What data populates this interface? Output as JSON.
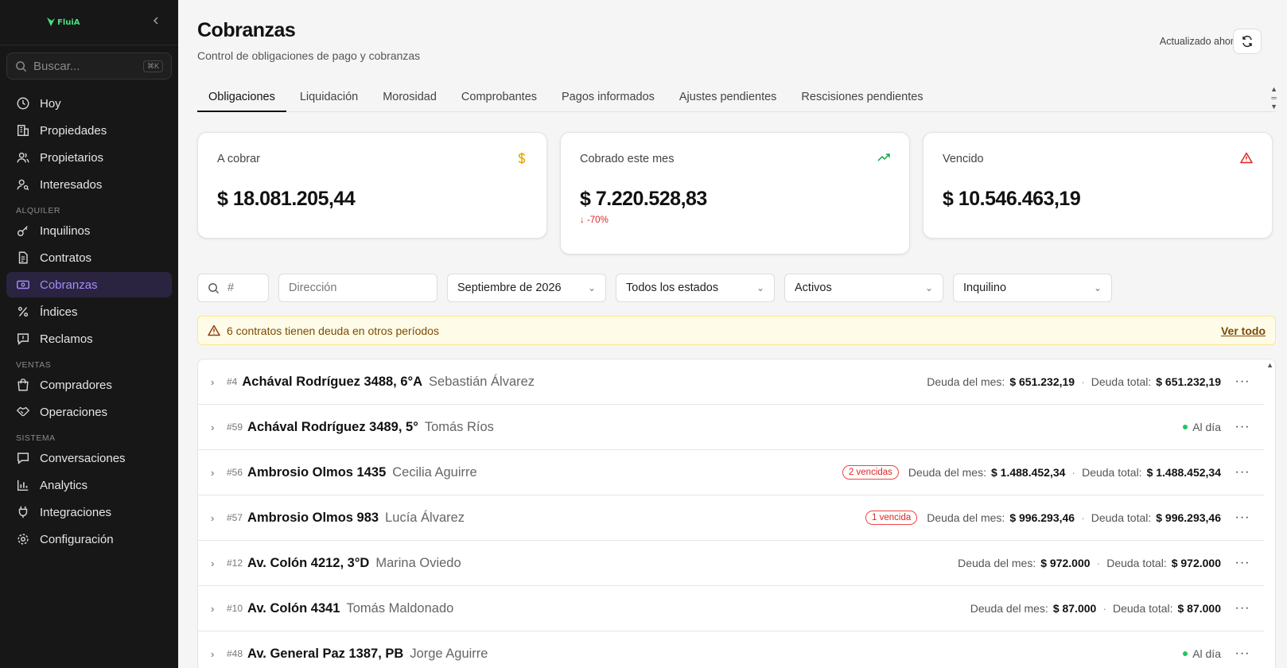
{
  "sidebar": {
    "logo": "FluiA",
    "search_placeholder": "Buscar...",
    "search_shortcut": "⌘K",
    "items_top": [
      {
        "label": "Hoy"
      },
      {
        "label": "Propiedades"
      },
      {
        "label": "Propietarios"
      },
      {
        "label": "Interesados"
      }
    ],
    "section_alquiler": "ALQUILER",
    "items_alquiler": [
      {
        "label": "Inquilinos"
      },
      {
        "label": "Contratos"
      },
      {
        "label": "Cobranzas"
      },
      {
        "label": "Índices"
      },
      {
        "label": "Reclamos"
      }
    ],
    "section_ventas": "VENTAS",
    "items_ventas": [
      {
        "label": "Compradores"
      },
      {
        "label": "Operaciones"
      }
    ],
    "section_sistema": "SISTEMA",
    "items_sistema": [
      {
        "label": "Conversaciones"
      },
      {
        "label": "Analytics"
      },
      {
        "label": "Integraciones"
      },
      {
        "label": "Configuración"
      }
    ],
    "active": "Cobranzas"
  },
  "header": {
    "title": "Cobranzas",
    "subtitle": "Control de obligaciones de pago y cobranzas",
    "updated": "Actualizado ahora"
  },
  "tabs": [
    {
      "label": "Obligaciones"
    },
    {
      "label": "Liquidación"
    },
    {
      "label": "Morosidad"
    },
    {
      "label": "Comprobantes"
    },
    {
      "label": "Pagos informados"
    },
    {
      "label": "Ajustes pendientes"
    },
    {
      "label": "Rescisiones pendientes"
    }
  ],
  "cards": {
    "a_cobrar": {
      "label": "A cobrar",
      "value": "$ 18.081.205,44"
    },
    "cobrado": {
      "label": "Cobrado este mes",
      "value": "$ 7.220.528,83",
      "delta": "-70%"
    },
    "vencido": {
      "label": "Vencido",
      "value": "$ 10.546.463,19"
    }
  },
  "filters": {
    "number_placeholder": "#",
    "address_placeholder": "Dirección",
    "period": "Septiembre de 2026",
    "status": "Todos los estados",
    "active": "Activos",
    "tenant": "Inquilino"
  },
  "alert": {
    "text": "6 contratos tienen deuda en otros períodos",
    "link": "Ver todo"
  },
  "labels": {
    "deuda_mes": "Deuda del mes:",
    "deuda_total": "Deuda total:",
    "al_dia": "Al día"
  },
  "rows": [
    {
      "num": "#4",
      "address": "Achával Rodríguez 3488, 6°A",
      "tenant": "Sebastián Álvarez",
      "badge": "",
      "status": "debt",
      "month": "$ 651.232,19",
      "total": "$ 651.232,19"
    },
    {
      "num": "#59",
      "address": "Achával Rodríguez 3489, 5°",
      "tenant": "Tomás Ríos",
      "badge": "",
      "status": "ok",
      "month": "",
      "total": ""
    },
    {
      "num": "#56",
      "address": "Ambrosio Olmos 1435",
      "tenant": "Cecilia Aguirre",
      "badge": "2 vencidas",
      "status": "debt",
      "month": "$ 1.488.452,34",
      "total": "$ 1.488.452,34"
    },
    {
      "num": "#57",
      "address": "Ambrosio Olmos 983",
      "tenant": "Lucía Álvarez",
      "badge": "1 vencida",
      "status": "debt",
      "month": "$ 996.293,46",
      "total": "$ 996.293,46"
    },
    {
      "num": "#12",
      "address": "Av. Colón 4212, 3°D",
      "tenant": "Marina Oviedo",
      "badge": "",
      "status": "debt",
      "month": "$ 972.000",
      "total": "$ 972.000"
    },
    {
      "num": "#10",
      "address": "Av. Colón 4341",
      "tenant": "Tomás Maldonado",
      "badge": "",
      "status": "debt",
      "month": "$ 87.000",
      "total": "$ 87.000"
    },
    {
      "num": "#48",
      "address": "Av. General Paz 1387, PB",
      "tenant": "Jorge Aguirre",
      "badge": "",
      "status": "ok",
      "month": "",
      "total": ""
    }
  ]
}
